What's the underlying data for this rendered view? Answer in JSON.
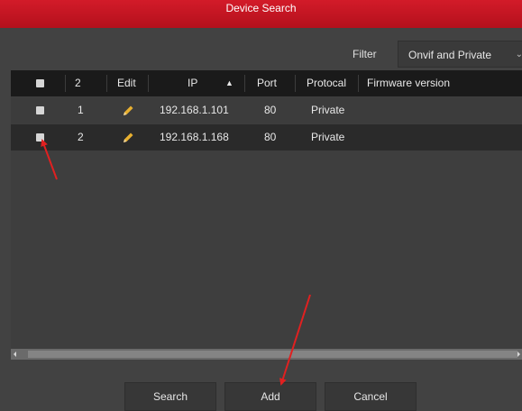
{
  "window": {
    "title": "Device Search"
  },
  "filter": {
    "label": "Filter",
    "value": "Onvif and Private"
  },
  "table": {
    "headers": {
      "count": "2",
      "edit": "Edit",
      "ip": "IP",
      "port": "Port",
      "protocol": "Protocal",
      "firmware": "Firmware version"
    },
    "sort_indicator": "▲",
    "rows": [
      {
        "index": "1",
        "ip": "192.168.1.101",
        "port": "80",
        "protocol": "Private",
        "firmware": ""
      },
      {
        "index": "2",
        "ip": "192.168.1.168",
        "port": "80",
        "protocol": "Private",
        "firmware": ""
      }
    ]
  },
  "buttons": {
    "search": "Search",
    "add": "Add",
    "cancel": "Cancel"
  },
  "icons": {
    "edit": "pencil-icon",
    "dropdown": "chevron-down-icon",
    "scroll_left": "arrow-left-icon",
    "scroll_right": "arrow-right-icon"
  },
  "colors": {
    "title_bar": "#c8141f",
    "pencil": "#e8b030",
    "annotation_arrow": "#e02020"
  }
}
